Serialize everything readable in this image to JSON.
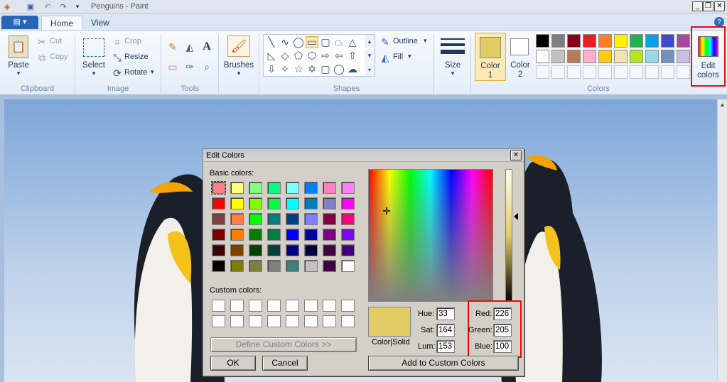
{
  "window": {
    "title": "Penguins - Paint",
    "min": "_",
    "restore": "❐",
    "close": "✕"
  },
  "tabs": [
    {
      "label": "Home"
    },
    {
      "label": "View"
    }
  ],
  "ribbon": {
    "clipboard": {
      "paste": "Paste",
      "cut": "Cut",
      "copy": "Copy",
      "group": "Clipboard"
    },
    "image": {
      "select": "Select",
      "crop": "Crop",
      "resize": "Resize",
      "rotate": "Rotate",
      "group": "Image"
    },
    "tools": {
      "group": "Tools"
    },
    "brushes": {
      "label": "Brushes"
    },
    "shapes": {
      "outline": "Outline",
      "fill": "Fill",
      "group": "Shapes"
    },
    "size": {
      "label": "Size"
    },
    "colors": {
      "color1": "Color",
      "color1_num": "1",
      "color2": "Color",
      "color2_num": "2",
      "edit1": "Edit",
      "edit2": "colors",
      "group": "Colors",
      "palette_row1": [
        "#000000",
        "#7f7f7f",
        "#880015",
        "#ed1c24",
        "#ff7f27",
        "#fff200",
        "#22b14c",
        "#00a2e8",
        "#3f48cc",
        "#a349a4"
      ],
      "palette_row2": [
        "#ffffff",
        "#c3c3c3",
        "#b97a57",
        "#ffaec9",
        "#ffc90e",
        "#efe4b0",
        "#b5e61d",
        "#99d9ea",
        "#7092be",
        "#c8bfe7"
      ],
      "color1_value": "#e2cd64"
    }
  },
  "dialog": {
    "title": "Edit Colors",
    "basic_label": "Basic colors:",
    "custom_label": "Custom colors:",
    "define_button": "Define Custom Colors >>",
    "ok": "OK",
    "cancel": "Cancel",
    "add_button": "Add to Custom Colors",
    "color_solid": "Color|Solid",
    "hue_label": "Hue:",
    "hue": "33",
    "sat_label": "Sat:",
    "sat": "164",
    "lum_label": "Lum:",
    "lum": "153",
    "red_label": "Red:",
    "red": "226",
    "green_label": "Green:",
    "green": "205",
    "blue_label": "Blue:",
    "blue": "100",
    "basic_colors": [
      [
        "#ff8080",
        "#ffff80",
        "#80ff80",
        "#00ff80",
        "#80ffff",
        "#0080ff",
        "#ff80c0",
        "#ff80ff"
      ],
      [
        "#ff0000",
        "#ffff00",
        "#80ff00",
        "#00ff40",
        "#00ffff",
        "#0080c0",
        "#8080c0",
        "#ff00ff"
      ],
      [
        "#804040",
        "#ff8040",
        "#00ff00",
        "#008080",
        "#004080",
        "#8080ff",
        "#800040",
        "#ff0080"
      ],
      [
        "#800000",
        "#ff8000",
        "#008000",
        "#008040",
        "#0000ff",
        "#0000a0",
        "#800080",
        "#8000ff"
      ],
      [
        "#400000",
        "#804000",
        "#004000",
        "#004040",
        "#000080",
        "#000040",
        "#400040",
        "#400080"
      ],
      [
        "#000000",
        "#808000",
        "#808040",
        "#808080",
        "#408080",
        "#c0c0c0",
        "#400040",
        "#ffffff"
      ]
    ]
  }
}
